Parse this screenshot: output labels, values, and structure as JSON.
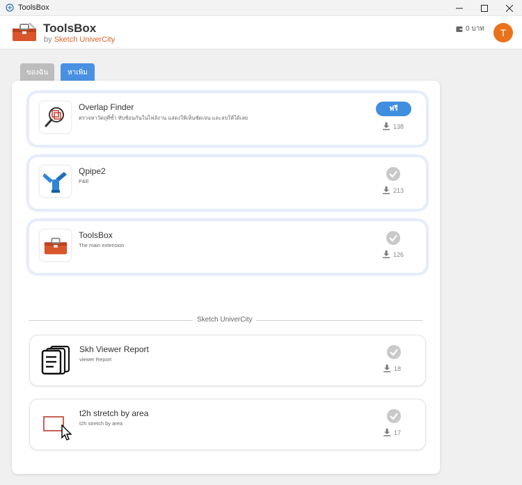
{
  "window": {
    "title": "ToolsBox"
  },
  "header": {
    "app_title": "ToolsBox",
    "subtitle_prefix": "by",
    "subtitle_brand": "Sketch UniverCity",
    "wallet": "0 บาท",
    "avatar_initial": "T"
  },
  "tabs": [
    {
      "label": "ของฉัน",
      "active": false
    },
    {
      "label": "หาเพิ่ม",
      "active": true
    }
  ],
  "extensions": [
    {
      "name": "Overlap Finder",
      "description": "ตรวจหาวัตถุที่ซ้ำ ทับซ้อนกันในไฟล์งาน แสดงให้เห็นชัดเจน และลบให้ได้เลย",
      "action": "ฟรี",
      "downloads": "138",
      "icon": "overlap-finder-icon"
    },
    {
      "name": "Qpipe2",
      "description": "P&E",
      "status": "installed",
      "downloads": "213",
      "icon": "pipe-fitting-icon"
    },
    {
      "name": "ToolsBox",
      "description": "The main extension",
      "status": "installed",
      "downloads": "126",
      "icon": "toolbox-icon"
    }
  ],
  "section_label": "Sketch UniverCity",
  "section_extensions": [
    {
      "name": "Skh Viewer Report",
      "description": "viewer Report",
      "status": "installed",
      "downloads": "18",
      "icon": "report-documents-icon"
    },
    {
      "name": "t2h stretch by area",
      "description": "t2h stretch by area",
      "status": "installed",
      "downloads": "17",
      "icon": "stretch-area-icon"
    }
  ],
  "colors": {
    "accent": "#4a90e2",
    "brand": "#d9652b",
    "avatar": "#e8731a"
  }
}
